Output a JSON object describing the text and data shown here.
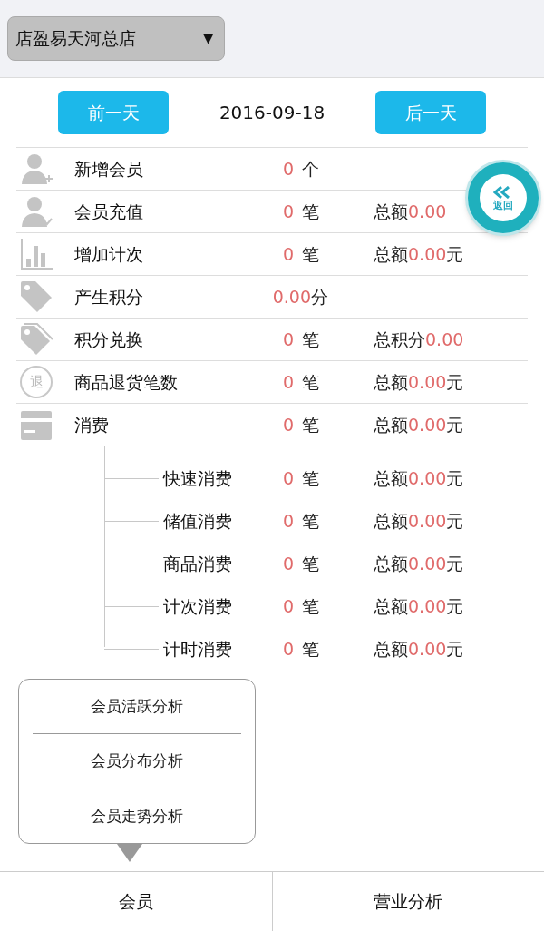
{
  "store_select": {
    "value": "店盈易天河总店",
    "caret": "▼"
  },
  "date_nav": {
    "prev": "前一天",
    "date": "2016-09-18",
    "next": "后一天"
  },
  "rows": [
    {
      "kind": "user-plus",
      "label": "新增会员",
      "count": "0",
      "unit": "个"
    },
    {
      "kind": "user-check",
      "label": "会员充值",
      "count": "0",
      "unit": "笔",
      "total_label": "总额",
      "total_value": "0.00"
    },
    {
      "kind": "bars",
      "label": "增加计次",
      "count": "0",
      "unit": "笔",
      "total_label": "总额",
      "total_value": "0.00",
      "total_unit": "元"
    },
    {
      "kind": "tag",
      "label": "产生积分",
      "count": "0.00",
      "unit": "分"
    },
    {
      "kind": "tags",
      "label": "积分兑换",
      "count": "0",
      "unit": "笔",
      "total_label": "总积分",
      "total_value": "0.00"
    },
    {
      "kind": "refund",
      "icon_text": "退",
      "label": "商品退货笔数",
      "count": "0",
      "unit": "笔",
      "total_label": "总额",
      "total_value": "0.00",
      "total_unit": "元"
    },
    {
      "kind": "card",
      "label": "消费",
      "count": "0",
      "unit": "笔",
      "total_label": "总额",
      "total_value": "0.00",
      "total_unit": "元",
      "children": [
        {
          "label": "快速消费",
          "count": "0",
          "unit": "笔",
          "total_label": "总额",
          "total_value": "0.00",
          "total_unit": "元"
        },
        {
          "label": "储值消费",
          "count": "0",
          "unit": "笔",
          "total_label": "总额",
          "total_value": "0.00",
          "total_unit": "元"
        },
        {
          "label": "商品消费",
          "count": "0",
          "unit": "笔",
          "total_label": "总额",
          "total_value": "0.00",
          "total_unit": "元"
        },
        {
          "label": "计次消费",
          "count": "0",
          "unit": "笔",
          "total_label": "总额",
          "total_value": "0.00",
          "total_unit": "元"
        },
        {
          "label": "计时消费",
          "count": "0",
          "unit": "笔",
          "total_label": "总额",
          "total_value": "0.00",
          "total_unit": "元"
        }
      ]
    }
  ],
  "float_button": {
    "label": "返回"
  },
  "popup_menu": [
    "会员活跃分析",
    "会员分布分析",
    "会员走势分析"
  ],
  "tabs": [
    "会员",
    "营业分析"
  ]
}
